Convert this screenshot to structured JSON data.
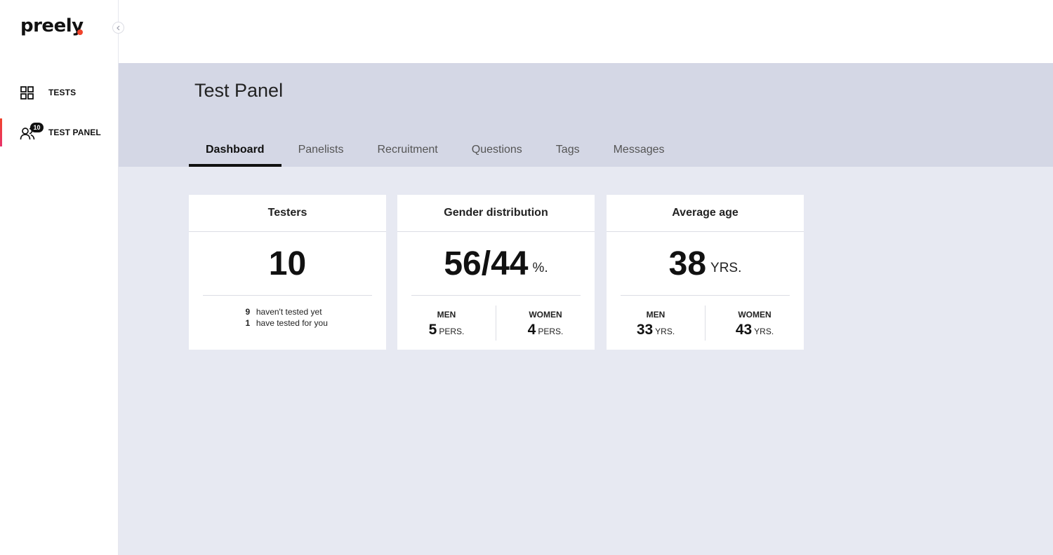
{
  "app": {
    "logo_text": "preely"
  },
  "sidebar": {
    "items": [
      {
        "label": "TESTS",
        "icon": "grid-icon"
      },
      {
        "label": "TEST PANEL",
        "icon": "users-icon",
        "badge": "10"
      }
    ]
  },
  "page": {
    "title": "Test Panel"
  },
  "tabs": [
    {
      "label": "Dashboard"
    },
    {
      "label": "Panelists"
    },
    {
      "label": "Recruitment"
    },
    {
      "label": "Questions"
    },
    {
      "label": "Tags"
    },
    {
      "label": "Messages"
    }
  ],
  "cards": {
    "testers": {
      "title": "Testers",
      "value": "10",
      "not_tested_count": "9",
      "not_tested_text": "haven't tested yet",
      "tested_count": "1",
      "tested_text": "have tested for you"
    },
    "gender": {
      "title": "Gender distribution",
      "value": "56/44",
      "unit": "%.",
      "men_label": "MEN",
      "men_value": "5",
      "men_unit": "PERS.",
      "women_label": "WOMEN",
      "women_value": "4",
      "women_unit": "PERS."
    },
    "age": {
      "title": "Average age",
      "value": "38",
      "unit": "YRS.",
      "men_label": "MEN",
      "men_value": "33",
      "men_unit": "YRS.",
      "women_label": "WOMEN",
      "women_value": "43",
      "women_unit": "YRS."
    }
  },
  "colors": {
    "accent": "#f0442c",
    "header_bg": "#d4d7e5",
    "content_bg": "#e7e9f2"
  }
}
